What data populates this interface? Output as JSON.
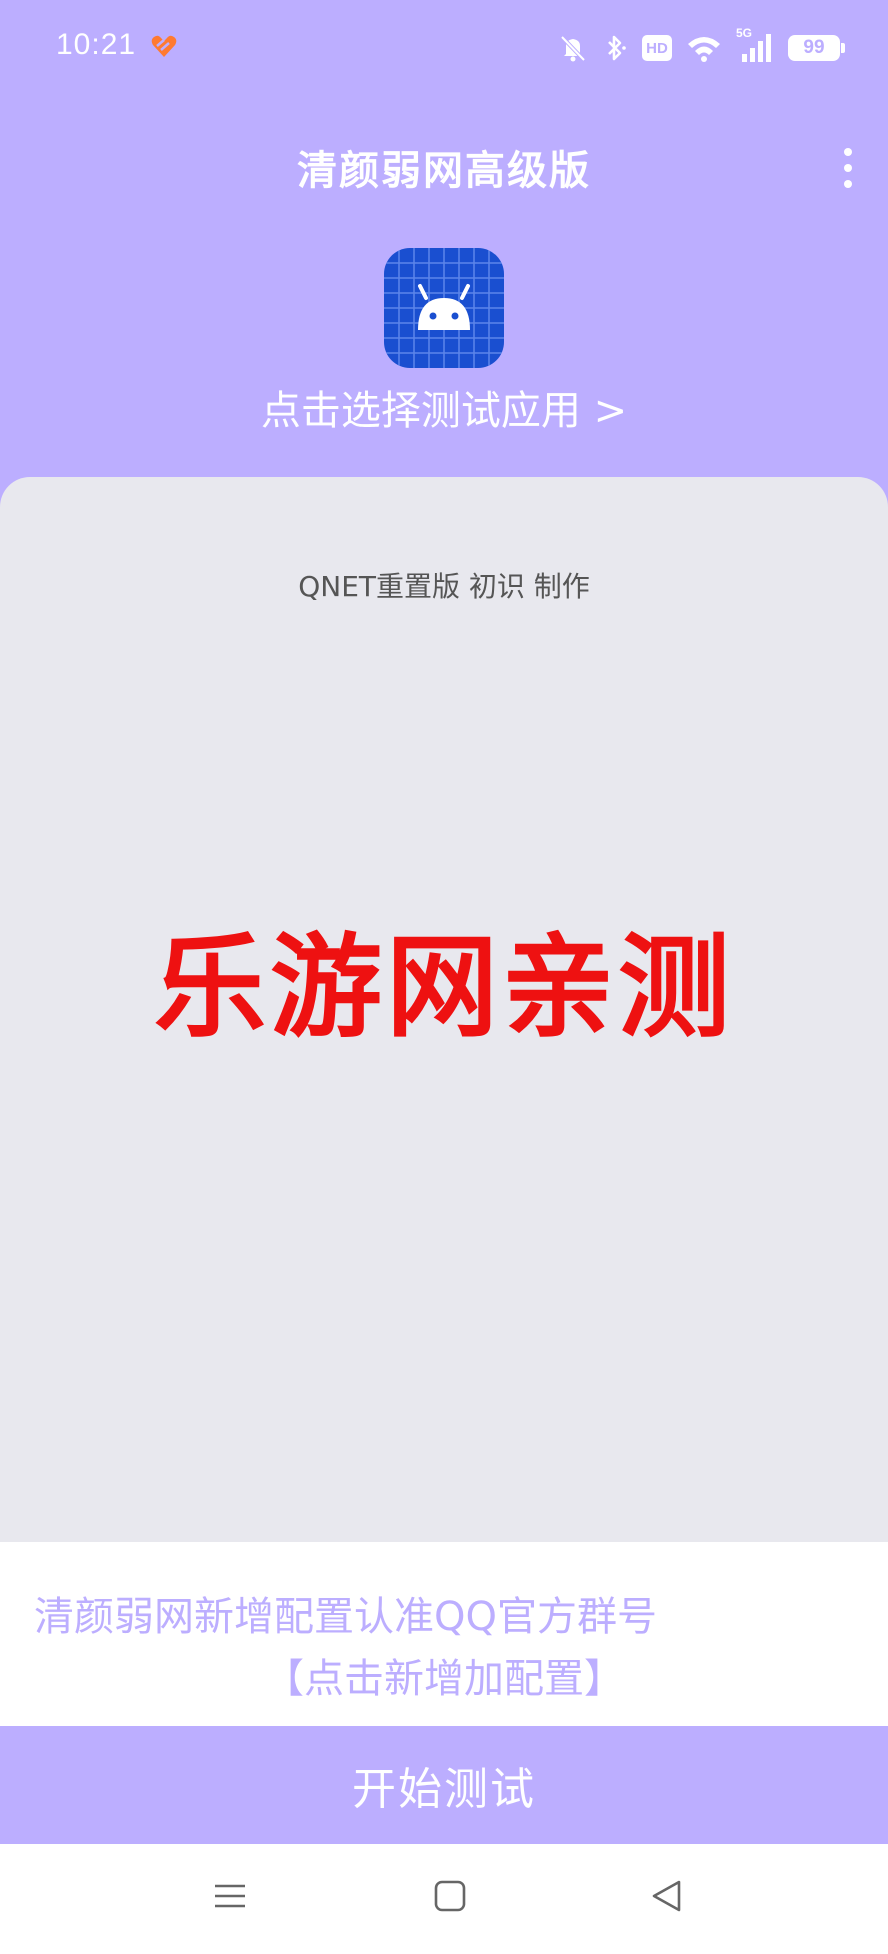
{
  "theme": {
    "accent": "#bcaeff",
    "watermark_color": "#ee1111"
  },
  "status_bar": {
    "time": "10:21",
    "hd_label": "HD",
    "network_label": "5G",
    "battery_level": "99",
    "icons": [
      "app-notification-icon",
      "bell-muted-icon",
      "bluetooth-icon",
      "hd-icon",
      "wifi-icon",
      "signal-5g-icon",
      "battery-icon"
    ]
  },
  "app_bar": {
    "title": "清颜弱网高级版",
    "more_icon": "more-vertical-icon"
  },
  "app_selector": {
    "icon": "android-app-icon",
    "label": "点击选择测试应用 >"
  },
  "content": {
    "credit": "QNET重置版 初识 制作",
    "watermark": "乐游网亲测"
  },
  "config": {
    "line1": "清颜弱网新增配置认准QQ官方群号",
    "line2": "【点击新增加配置】"
  },
  "start_button": {
    "label": "开始测试"
  },
  "nav_bar": {
    "icons": [
      "menu-icon",
      "home-icon",
      "back-icon"
    ]
  }
}
